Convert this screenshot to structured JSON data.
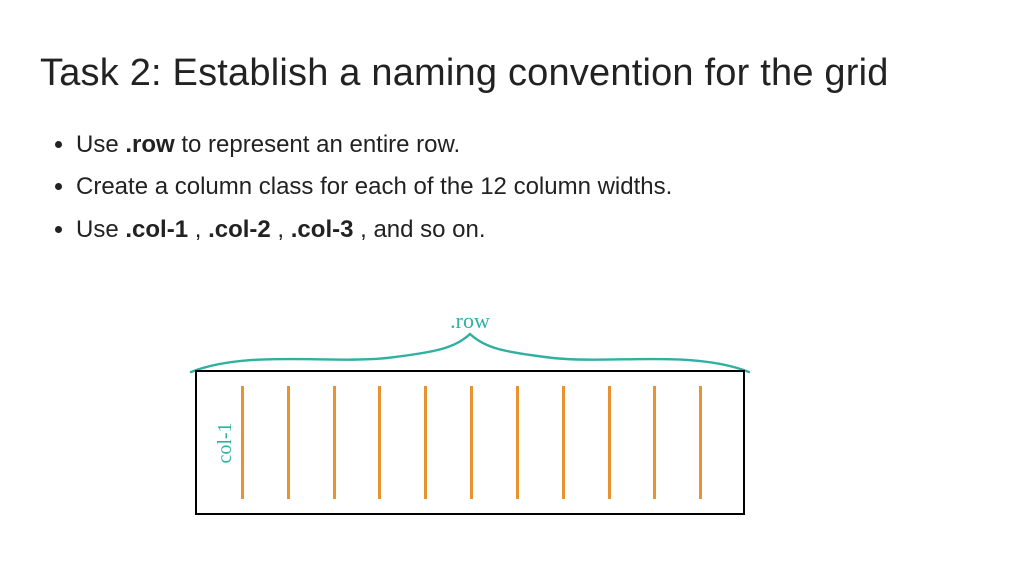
{
  "title": "Task 2: Establish a naming convention for the grid",
  "bullets": [
    {
      "pre": "Use ",
      "code": ".row",
      "post": " to represent an entire row."
    },
    {
      "pre": "Create a column class for each of the 12 column widths.",
      "code": "",
      "post": ""
    },
    {
      "pre": "Use ",
      "code": ".col-1",
      "mid1": " , ",
      "code2": ".col-2",
      "mid2": " , ",
      "code3": ".col-3",
      "post": " , and so on."
    }
  ],
  "illustration": {
    "row_label": ".row",
    "col1_label": "col-1",
    "column_count": 12
  }
}
